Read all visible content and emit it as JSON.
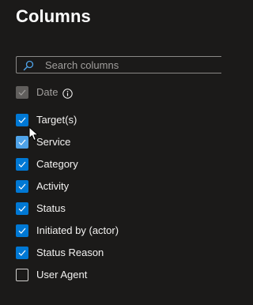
{
  "panel": {
    "title": "Columns"
  },
  "search": {
    "placeholder": "Search columns",
    "value": ""
  },
  "columns": [
    {
      "label": "Date",
      "checked": true,
      "disabled": true,
      "has_info": true
    },
    {
      "label": "Target(s)",
      "checked": true,
      "disabled": false
    },
    {
      "label": "Service",
      "checked": true,
      "disabled": false,
      "hovered": true
    },
    {
      "label": "Category",
      "checked": true,
      "disabled": false
    },
    {
      "label": "Activity",
      "checked": true,
      "disabled": false
    },
    {
      "label": "Status",
      "checked": true,
      "disabled": false
    },
    {
      "label": "Initiated by (actor)",
      "checked": true,
      "disabled": false
    },
    {
      "label": "Status Reason",
      "checked": true,
      "disabled": false
    },
    {
      "label": "User Agent",
      "checked": false,
      "disabled": false
    }
  ],
  "colors": {
    "background": "#1b1a19",
    "accent": "#0078d4",
    "accent_hover": "#4fa3e8",
    "disabled": "#605e5c",
    "text": "#f3f2f1",
    "muted_text": "#a19f9d"
  },
  "icons": {
    "search": "search-icon",
    "info": "info-icon",
    "check": "checkmark-icon",
    "cursor": "mouse-pointer-icon"
  }
}
